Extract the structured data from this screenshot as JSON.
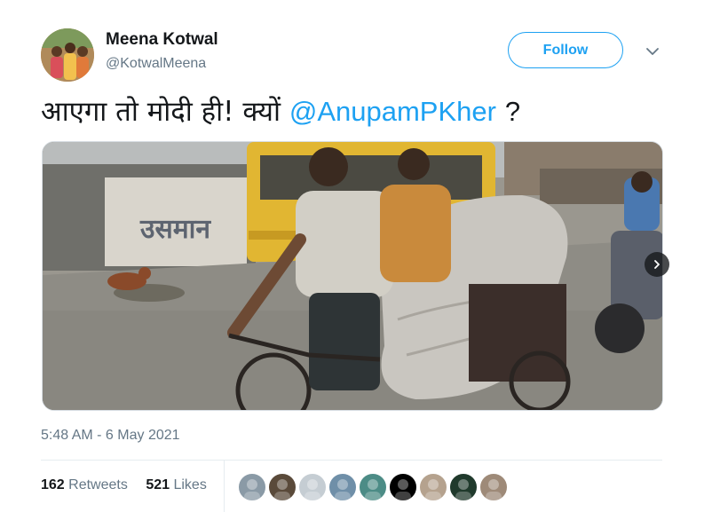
{
  "author": {
    "name": "Meena Kotwal",
    "handle": "@KotwalMeena"
  },
  "follow_label": "Follow",
  "tweet": {
    "text": "आएगा तो मोदी ही! क्यों",
    "mention": "@AnupamPKher",
    "trail": "?"
  },
  "media": {
    "wall_text": "उसमान"
  },
  "timestamp": "5:48 AM - 6 May 2021",
  "stats": {
    "retweets_count": "162",
    "retweets_label": "Retweets",
    "likes_count": "521",
    "likes_label": "Likes"
  },
  "likers": [
    "#8a9aa6",
    "#5a4a3a",
    "#c5cdd3",
    "#6f8fa8",
    "#4c8c86",
    "#000000",
    "#b5a28e",
    "#203a2c",
    "#9e8a78"
  ],
  "colors": {
    "accent": "#1da1f2",
    "text": "#14171a",
    "muted": "#657786",
    "divider": "#e6ecf0"
  },
  "icons": [
    "chevron-down-icon",
    "next-arrow-icon"
  ]
}
